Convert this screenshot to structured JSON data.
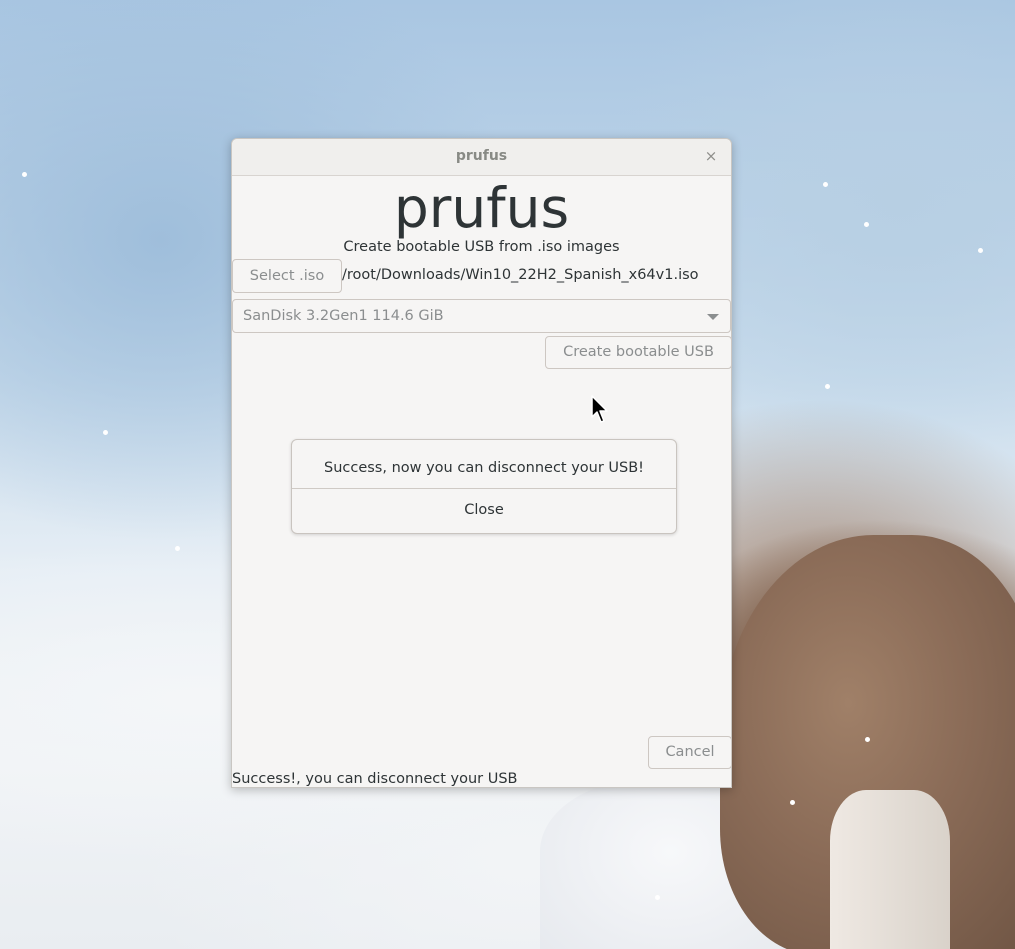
{
  "window": {
    "title": "prufus",
    "close_glyph": "×",
    "close_icon": "close-icon"
  },
  "app": {
    "heading": "prufus",
    "subtitle": "Create bootable USB from .iso images"
  },
  "iso": {
    "select_label": "Select .iso",
    "path": "/root/Downloads/Win10_22H2_Spanish_x64v1.iso"
  },
  "device": {
    "selected": "SanDisk 3.2Gen1 114.6 GiB",
    "dropdown_icon": "chevron-down-icon"
  },
  "actions": {
    "create_label": "Create bootable USB",
    "cancel_label": "Cancel"
  },
  "dialog": {
    "message": "Success, now you can disconnect your USB!",
    "close_label": "Close"
  },
  "status": {
    "text": "Success!, you can disconnect your USB"
  },
  "colors": {
    "window_bg": "#f6f5f4",
    "text": "#2e3436",
    "disabled_text": "#8b8e8f",
    "border": "#cdc7c2"
  }
}
